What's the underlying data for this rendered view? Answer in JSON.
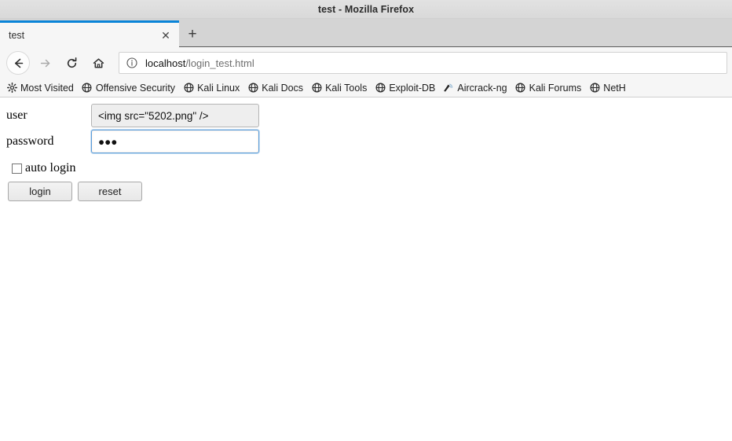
{
  "window": {
    "title": "test - Mozilla Firefox"
  },
  "tabs": {
    "active": {
      "label": "test",
      "close_icon": "close-icon"
    },
    "new_tab_icon": "plus-icon"
  },
  "toolbar": {
    "back_icon": "back-arrow-icon",
    "forward_icon": "forward-arrow-icon",
    "reload_icon": "reload-icon",
    "home_icon": "home-icon",
    "url": {
      "identity_icon": "info-circle-icon",
      "host": "localhost",
      "path": "/login_test.html"
    }
  },
  "bookmarks": [
    {
      "label": "Most Visited",
      "icon": "gear-icon"
    },
    {
      "label": "Offensive Security",
      "icon": "globe-icon"
    },
    {
      "label": "Kali Linux",
      "icon": "globe-icon"
    },
    {
      "label": "Kali Docs",
      "icon": "globe-icon"
    },
    {
      "label": "Kali Tools",
      "icon": "globe-icon"
    },
    {
      "label": "Exploit-DB",
      "icon": "globe-icon"
    },
    {
      "label": "Aircrack-ng",
      "icon": "antenna-icon"
    },
    {
      "label": "Kali Forums",
      "icon": "globe-icon"
    },
    {
      "label": "NetH",
      "icon": "globe-icon"
    }
  ],
  "page": {
    "user": {
      "label": "user",
      "value": "<img src=\"5202.png\" />"
    },
    "password": {
      "label": "password",
      "value": "●●●"
    },
    "auto_login": {
      "label": "auto login",
      "checked": false
    },
    "login_button": "login",
    "reset_button": "reset"
  },
  "colors": {
    "tab_accent": "#0a84d8",
    "focus_border": "#5b9dd9",
    "chrome_bg": "#f6f6f6",
    "tabstrip_bg": "#d4d4d4"
  }
}
